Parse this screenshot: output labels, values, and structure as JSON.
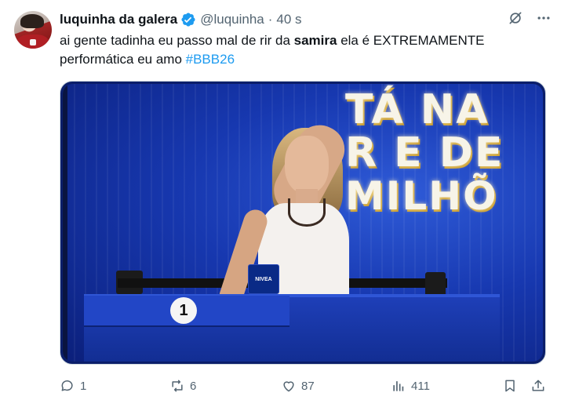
{
  "tweet": {
    "author": {
      "name": "luquinha da galera",
      "handle": "@luquinha",
      "time": "40 s"
    },
    "text": {
      "part1": "ai gente tadinha eu passo mal de rir da ",
      "bold": "samira",
      "part2": " ela é EXTREMAMENTE performática eu amo ",
      "hashtag": "#BBB26"
    },
    "media": {
      "banner": {
        "line1": "TÁ NA",
        "line2": "R E DE",
        "line3": "MILHÕ"
      },
      "podium_number": "1",
      "brand_label": "NIVEA"
    },
    "metrics": {
      "replies": "1",
      "reposts": "6",
      "likes": "87",
      "views": "411"
    },
    "icons": {
      "verified": "verified-badge-icon",
      "grok": "grok-icon",
      "more": "more-options-icon",
      "reply": "reply-icon",
      "repost": "repost-icon",
      "like": "like-icon",
      "views": "views-icon",
      "bookmark": "bookmark-icon",
      "share": "share-icon"
    },
    "colors": {
      "accent": "#1d9bf0",
      "muted": "#536471",
      "text": "#0f1419"
    }
  }
}
